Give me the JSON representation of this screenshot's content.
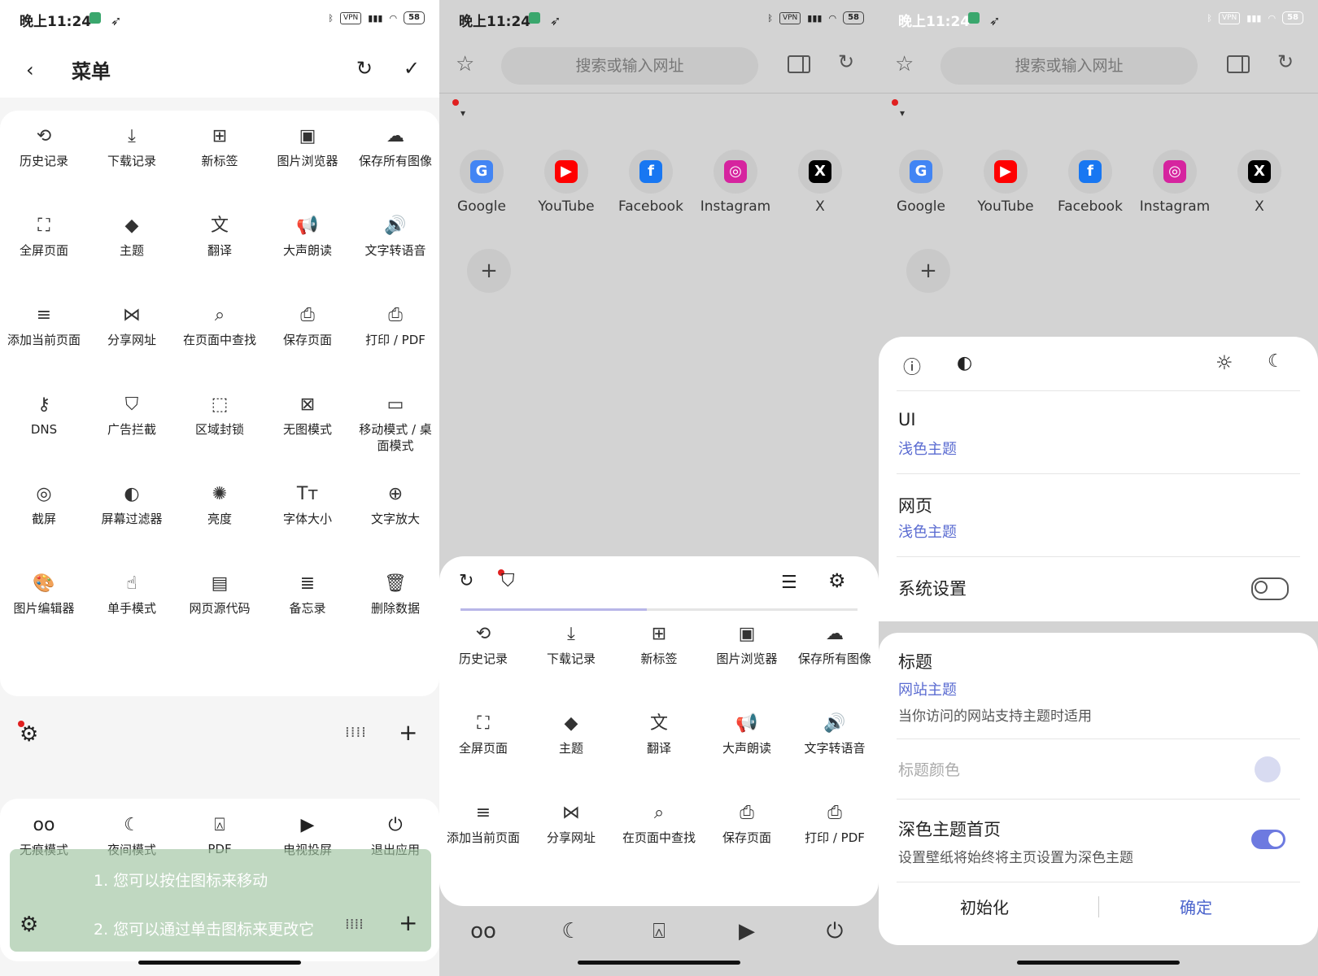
{
  "status": {
    "time": "晚上11:24",
    "vpn": "VPN",
    "battery": "58"
  },
  "menu": {
    "title": "菜单",
    "items": [
      {
        "label": "历史记录",
        "icon": "history-icon",
        "glyph": "⟲"
      },
      {
        "label": "下载记录",
        "icon": "download-icon",
        "glyph": "⤓"
      },
      {
        "label": "新标签",
        "icon": "new-tab-icon",
        "glyph": "⊞"
      },
      {
        "label": "图片浏览器",
        "icon": "image-viewer-icon",
        "glyph": "▣"
      },
      {
        "label": "保存所有图像",
        "icon": "cloud-download-icon",
        "glyph": "☁"
      },
      {
        "label": "全屏页面",
        "icon": "fullscreen-icon",
        "glyph": "⛶"
      },
      {
        "label": "主题",
        "icon": "paint-bucket-icon",
        "glyph": "◆"
      },
      {
        "label": "翻译",
        "icon": "translate-icon",
        "glyph": "文"
      },
      {
        "label": "大声朗读",
        "icon": "megaphone-icon",
        "glyph": "📢"
      },
      {
        "label": "文字转语音",
        "icon": "text-to-speech-icon",
        "glyph": "🔊"
      },
      {
        "label": "添加当前页面",
        "icon": "add-list-icon",
        "glyph": "≡"
      },
      {
        "label": "分享网址",
        "icon": "share-icon",
        "glyph": "⋈"
      },
      {
        "label": "在页面中查找",
        "icon": "find-in-page-icon",
        "glyph": "⌕"
      },
      {
        "label": "保存页面",
        "icon": "save-page-icon",
        "glyph": "⎙"
      },
      {
        "label": "打印 / PDF",
        "icon": "print-icon",
        "glyph": "⎙"
      },
      {
        "label": "DNS",
        "icon": "key-icon",
        "glyph": "⚷"
      },
      {
        "label": "广告拦截",
        "icon": "shield-icon",
        "glyph": "⛉"
      },
      {
        "label": "区域封锁",
        "icon": "block-area-icon",
        "glyph": "⬚"
      },
      {
        "label": "无图模式",
        "icon": "no-image-icon",
        "glyph": "⊠"
      },
      {
        "label": "移动模式 / 桌面模式",
        "icon": "desktop-icon",
        "glyph": "▭"
      },
      {
        "label": "截屏",
        "icon": "screenshot-icon",
        "glyph": "◎"
      },
      {
        "label": "屏幕过滤器",
        "icon": "screen-filter-icon",
        "glyph": "◐"
      },
      {
        "label": "亮度",
        "icon": "brightness-icon",
        "glyph": "✺"
      },
      {
        "label": "字体大小",
        "icon": "font-size-icon",
        "glyph": "Tт"
      },
      {
        "label": "文字放大",
        "icon": "zoom-in-icon",
        "glyph": "⊕"
      },
      {
        "label": "图片编辑器",
        "icon": "palette-icon",
        "glyph": "🎨"
      },
      {
        "label": "单手模式",
        "icon": "hand-icon",
        "glyph": "☝"
      },
      {
        "label": "网页源代码",
        "icon": "source-code-icon",
        "glyph": "▤"
      },
      {
        "label": "备忘录",
        "icon": "memo-icon",
        "glyph": "≣"
      },
      {
        "label": "删除数据",
        "icon": "delete-data-icon",
        "glyph": "🗑"
      }
    ],
    "bottom": [
      {
        "label": "无痕模式",
        "icon": "incognito-icon",
        "glyph": "oo"
      },
      {
        "label": "夜间模式",
        "icon": "moon-icon",
        "glyph": "☾"
      },
      {
        "label": "PDF",
        "icon": "pdf-icon",
        "glyph": "⍓"
      },
      {
        "label": "电视投屏",
        "icon": "cast-icon",
        "glyph": "▶"
      },
      {
        "label": "退出应用",
        "icon": "power-icon",
        "glyph": "⏻"
      }
    ],
    "tip_line1": "1. 您可以按住图标来移动",
    "tip_line2": "2. 您可以通过单击图标来更改它"
  },
  "browser": {
    "search_placeholder": "搜索或输入网址",
    "shortcuts": [
      {
        "label": "Google",
        "letter": "G",
        "color": "#4285f4"
      },
      {
        "label": "YouTube",
        "letter": "▶",
        "color": "#ff0000"
      },
      {
        "label": "Facebook",
        "letter": "f",
        "color": "#1877f2"
      },
      {
        "label": "Instagram",
        "letter": "◎",
        "color": "#d6249f"
      },
      {
        "label": "X",
        "letter": "X",
        "color": "#000000"
      }
    ],
    "sheet_progress": 0.47
  },
  "theme_panel": {
    "ui_title": "UI",
    "ui_value": "浅色主题",
    "web_title": "网页",
    "web_value": "浅色主题",
    "system_title": "系统设置",
    "system_on": false,
    "header_title": "标题",
    "header_value": "网站主题",
    "header_sub": "当你访问的网站支持主题时适用",
    "header_color": "标题颜色",
    "dark_home_title": "深色主题首页",
    "dark_home_sub": "设置壁纸将始终将主页设置为深色主题",
    "dark_home_on": true,
    "reset": "初始化",
    "ok": "确定",
    "accent": "#5a6bd1"
  }
}
